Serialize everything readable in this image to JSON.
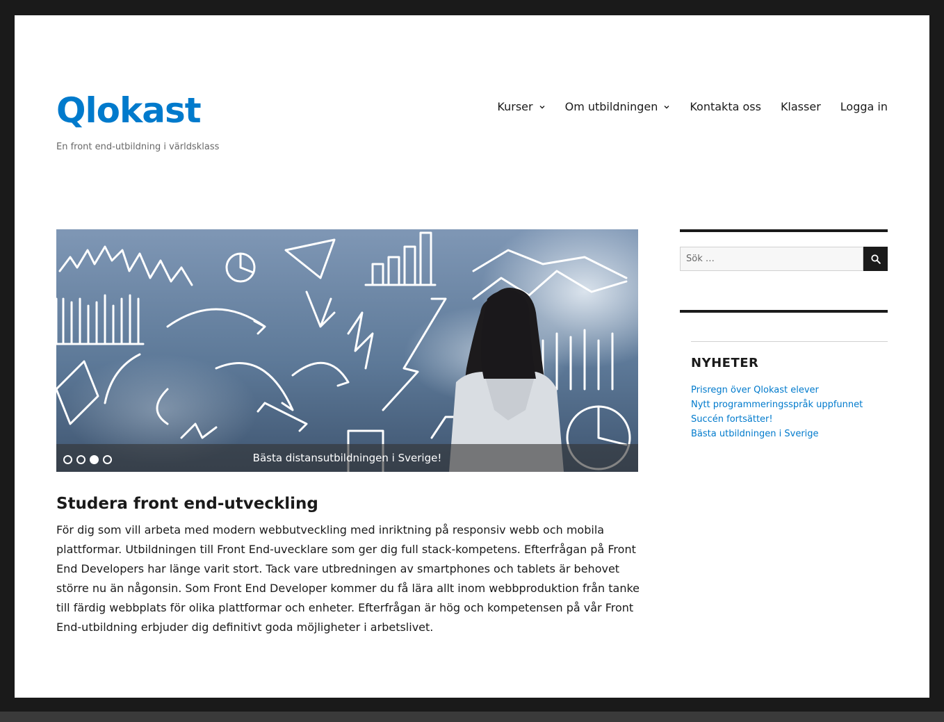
{
  "header": {
    "site_title": "Qlokast",
    "site_description": "En front end-utbildning i världsklass"
  },
  "nav": {
    "items": [
      {
        "label": "Kurser",
        "has_submenu": true
      },
      {
        "label": "Om utbildningen",
        "has_submenu": true
      },
      {
        "label": "Kontakta oss",
        "has_submenu": false
      },
      {
        "label": "Klasser",
        "has_submenu": false
      },
      {
        "label": "Logga in",
        "has_submenu": false
      }
    ]
  },
  "slider": {
    "caption": "Bästa distansutbildningen i Sverige!",
    "slide_count": 4,
    "active_slide": 3
  },
  "article": {
    "title": "Studera front end-utveckling",
    "body": "För dig som vill arbeta med modern webbutveckling med inriktning på responsiv webb och mobila plattformar. Utbildningen till Front End-uvecklare som ger dig full stack-kompetens. Efterfrågan på Front End Developers har länge varit stort. Tack vare utbredningen av smartphones och tablets är behovet större nu än någonsin. Som Front End Developer kommer du få lära allt inom webbproduktion från tanke till färdig webbplats för olika plattformar och enheter. Efterfrågan är hög och kompetensen på vår Front End-utbildning erbjuder dig definitivt goda möjligheter i arbetslivet."
  },
  "sidebar": {
    "search": {
      "placeholder": "Sök …",
      "icon": "search-icon"
    },
    "news": {
      "title": "NYHETER",
      "items": [
        "Prisregn över Qlokast elever",
        "Nytt programmeringsspråk uppfunnet",
        "Succén fortsätter!",
        "Bästa utbildningen i Sverige"
      ]
    }
  },
  "colors": {
    "accent": "#007acc",
    "text": "#1a1a1a",
    "frame": "#1a1a1a"
  }
}
